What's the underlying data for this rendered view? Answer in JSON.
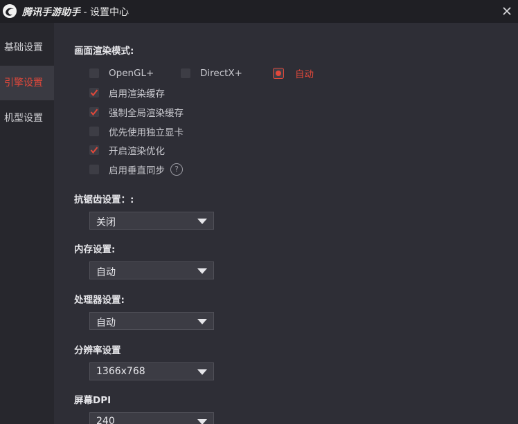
{
  "window": {
    "brand": "腾讯手游助手",
    "separator": " - ",
    "title": "设置中心",
    "close_symbol": "×"
  },
  "sidebar": {
    "items": [
      {
        "label": "基础设置",
        "active": false
      },
      {
        "label": "引擎设置",
        "active": true
      },
      {
        "label": "机型设置",
        "active": false
      }
    ]
  },
  "render_mode": {
    "label": "画面渲染模式:",
    "options": [
      {
        "label": "OpenGL+",
        "selected": false
      },
      {
        "label": "DirectX+",
        "selected": false
      },
      {
        "label": "自动",
        "selected": true
      }
    ]
  },
  "checkboxes": [
    {
      "label": "启用渲染缓存",
      "checked": true
    },
    {
      "label": "强制全局渲染缓存",
      "checked": true
    },
    {
      "label": "优先使用独立显卡",
      "checked": false
    },
    {
      "label": "开启渲染优化",
      "checked": true
    },
    {
      "label": "启用垂直同步",
      "checked": false,
      "help": "?"
    }
  ],
  "antialias": {
    "label": "抗锯齿设置：:",
    "value": "关闭"
  },
  "memory": {
    "label": "内存设置:",
    "value": "自动"
  },
  "cpu": {
    "label": "处理器设置:",
    "value": "自动"
  },
  "resolution": {
    "label": "分辨率设置",
    "value": "1366x768"
  },
  "dpi": {
    "label": "屏幕DPI",
    "value": "240"
  },
  "colors": {
    "accent": "#e0483b",
    "background": "#2e2e36",
    "sidebar": "#27272d",
    "titlebar": "#1f1f24"
  }
}
